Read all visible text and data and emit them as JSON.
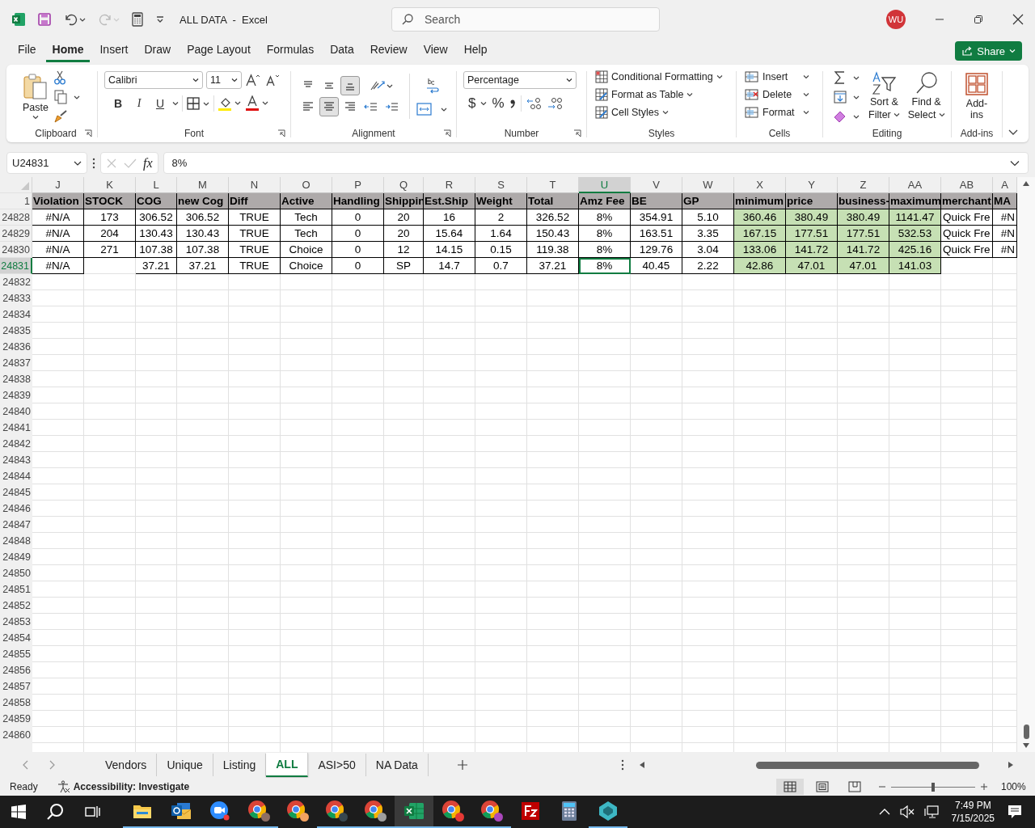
{
  "titlebar": {
    "title": "ALL DATA  -  Excel",
    "search": {
      "placeholder": "Search"
    },
    "avatar": "WU"
  },
  "menu_tabs": [
    {
      "label": "File",
      "selected": false
    },
    {
      "label": "Home",
      "selected": true
    },
    {
      "label": "Insert",
      "selected": false
    },
    {
      "label": "Draw",
      "selected": false
    },
    {
      "label": "Page Layout",
      "selected": false
    },
    {
      "label": "Formulas",
      "selected": false
    },
    {
      "label": "Data",
      "selected": false
    },
    {
      "label": "Review",
      "selected": false
    },
    {
      "label": "View",
      "selected": false
    },
    {
      "label": "Help",
      "selected": false
    }
  ],
  "share_button": {
    "label": "Share"
  },
  "ribbon": {
    "clipboard": {
      "paste": "Paste",
      "label": "Clipboard"
    },
    "font": {
      "name": "Calibri",
      "size": "11",
      "bold": "B",
      "italic": "I",
      "underline": "U",
      "label": "Font"
    },
    "alignment": {
      "items": [
        {
          "kind": "top",
          "selected": false
        },
        {
          "kind": "middle",
          "selected": false
        },
        {
          "kind": "bottom",
          "selected": true
        },
        {
          "kind": "left",
          "selected": false
        },
        {
          "kind": "center",
          "selected": true
        },
        {
          "kind": "right",
          "selected": false
        }
      ],
      "label": "Alignment"
    },
    "number": {
      "format": "Percentage",
      "currency": "$",
      "percent": "%",
      "label": "Number"
    },
    "styles": {
      "items": [
        "Conditional Formatting",
        "Format as Table",
        "Cell Styles"
      ],
      "label": "Styles"
    },
    "cells": {
      "items": [
        "Insert",
        "Delete",
        "Format"
      ],
      "label": "Cells"
    },
    "editing": {
      "sort": [
        "Sort &",
        "Filter"
      ],
      "find": [
        "Find &",
        "Select"
      ],
      "label": "Editing"
    },
    "addins": {
      "button": "Add-ins",
      "label": "Add-ins"
    }
  },
  "formula_bar": {
    "name_box": "U24831",
    "fx": "fx",
    "value": "8%"
  },
  "sheet": {
    "header_row": "1",
    "columns": [
      {
        "letter": "J",
        "header": "Violation",
        "selected": false,
        "highlight": false
      },
      {
        "letter": "K",
        "header": "STOCK",
        "selected": false,
        "highlight": false
      },
      {
        "letter": "L",
        "header": "COG",
        "selected": false,
        "highlight": false
      },
      {
        "letter": "M",
        "header": "new Cog",
        "selected": false,
        "highlight": false
      },
      {
        "letter": "N",
        "header": "Diff",
        "selected": false,
        "highlight": false
      },
      {
        "letter": "O",
        "header": "Active",
        "selected": false,
        "highlight": false
      },
      {
        "letter": "P",
        "header": "Handling",
        "selected": false,
        "highlight": false
      },
      {
        "letter": "Q",
        "header": "Shippin",
        "selected": false,
        "highlight": false
      },
      {
        "letter": "R",
        "header": "Est.Ship",
        "selected": false,
        "highlight": false
      },
      {
        "letter": "S",
        "header": "Weight",
        "selected": false,
        "highlight": false
      },
      {
        "letter": "T",
        "header": "Total",
        "selected": false,
        "highlight": false
      },
      {
        "letter": "U",
        "header": "Amz Fee",
        "selected": true,
        "highlight": false
      },
      {
        "letter": "V",
        "header": "BE",
        "selected": false,
        "highlight": false
      },
      {
        "letter": "W",
        "header": "GP",
        "selected": false,
        "highlight": false
      },
      {
        "letter": "X",
        "header": "minimum",
        "selected": false,
        "highlight": true
      },
      {
        "letter": "Y",
        "header": "price",
        "selected": false,
        "highlight": true
      },
      {
        "letter": "Z",
        "header": "business-",
        "selected": false,
        "highlight": true
      },
      {
        "letter": "AA",
        "header": "maximum",
        "selected": false,
        "highlight": true
      },
      {
        "letter": "AB",
        "header": "merchant",
        "selected": false,
        "highlight": false
      },
      {
        "letter": "A",
        "header": "MA",
        "selected": false,
        "highlight": false
      }
    ],
    "rows": [
      {
        "number": "24828",
        "selected": false,
        "cells": [
          "#N/A",
          "173",
          "306.52",
          "306.52",
          "TRUE",
          "Tech",
          "0",
          "20",
          "16",
          "2",
          "326.52",
          "8%",
          "354.91",
          "5.10",
          "360.46",
          "380.49",
          "380.49",
          "1141.47",
          "Quick Fre",
          "#N"
        ]
      },
      {
        "number": "24829",
        "selected": false,
        "cells": [
          "#N/A",
          "204",
          "130.43",
          "130.43",
          "TRUE",
          "Tech",
          "0",
          "20",
          "15.64",
          "1.64",
          "150.43",
          "8%",
          "163.51",
          "3.35",
          "167.15",
          "177.51",
          "177.51",
          "532.53",
          "Quick Fre",
          "#N"
        ]
      },
      {
        "number": "24830",
        "selected": false,
        "cells": [
          "#N/A",
          "271",
          "107.38",
          "107.38",
          "TRUE",
          "Choice",
          "0",
          "12",
          "14.15",
          "0.15",
          "119.38",
          "8%",
          "129.76",
          "3.04",
          "133.06",
          "141.72",
          "141.72",
          "425.16",
          "Quick Fre",
          "#N"
        ]
      },
      {
        "number": "24831",
        "selected": true,
        "cells": [
          "#N/A",
          null,
          "37.21",
          "37.21",
          "TRUE",
          "Choice",
          "0",
          "SP",
          "14.7",
          "0.7",
          "37.21",
          "8%",
          "40.45",
          "2.22",
          "42.86",
          "47.01",
          "47.01",
          "141.03",
          null,
          null
        ]
      }
    ],
    "empty_rows": [
      "24832",
      "24833",
      "24834",
      "24835",
      "24836",
      "24837",
      "24838",
      "24839",
      "24840",
      "24841",
      "24842",
      "24843",
      "24844",
      "24845",
      "24846",
      "24847",
      "24848",
      "24849",
      "24850",
      "24851",
      "24852",
      "24853",
      "24854",
      "24855",
      "24856",
      "24857",
      "24858",
      "24859",
      "24860"
    ]
  },
  "sheet_tabs": [
    {
      "label": "Vendors",
      "selected": false
    },
    {
      "label": "Unique",
      "selected": false
    },
    {
      "label": "Listing",
      "selected": false
    },
    {
      "label": "ALL",
      "selected": true
    },
    {
      "label": "ASI>50",
      "selected": false
    },
    {
      "label": "NA Data",
      "selected": false
    }
  ],
  "status_bar": {
    "ready": "Ready",
    "accessibility": "Accessibility: Investigate",
    "views": [
      {
        "kind": "normal",
        "selected": true
      },
      {
        "kind": "page_layout",
        "selected": false
      },
      {
        "kind": "page_break",
        "selected": false
      }
    ],
    "zoom": {
      "level": 0.5,
      "reading": "100%"
    }
  },
  "taskbar": {
    "apps": [
      {
        "kind": "explorer",
        "running": true,
        "selected": false
      },
      {
        "kind": "outlook",
        "running": true,
        "selected": false
      },
      {
        "kind": "zoom",
        "running": true,
        "selected": false
      },
      {
        "kind": "chrome",
        "running": true,
        "selected": false,
        "color": "#8d6e63"
      },
      {
        "kind": "chrome",
        "running": false,
        "selected": false,
        "color": "#f4a261"
      },
      {
        "kind": "chrome",
        "running": true,
        "selected": false,
        "color": "#37474f"
      },
      {
        "kind": "chrome",
        "running": true,
        "selected": false,
        "color": "#9e9e9e"
      },
      {
        "kind": "excel",
        "running": true,
        "selected": true
      },
      {
        "kind": "chrome",
        "running": true,
        "selected": false,
        "color": "#e53935"
      },
      {
        "kind": "chrome",
        "running": true,
        "selected": false,
        "color": "#ab47bc"
      },
      {
        "kind": "filezilla",
        "running": false,
        "selected": false
      },
      {
        "kind": "calculator",
        "running": false,
        "selected": false
      },
      {
        "kind": "diamond",
        "running": true,
        "selected": false
      }
    ],
    "time": "7:49 PM",
    "date": "7/15/2025"
  }
}
